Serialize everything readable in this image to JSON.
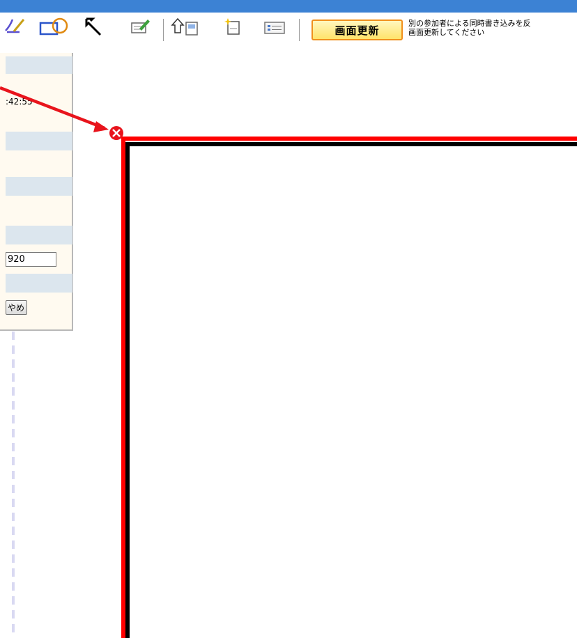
{
  "toolbar": {
    "tools": [
      {
        "icon": "pen-icon"
      },
      {
        "icon": "shape-icon"
      },
      {
        "icon": "select-arrow-icon"
      },
      {
        "icon": "edit-note-icon"
      },
      {
        "icon": "upload-page-icon"
      },
      {
        "icon": "new-page-icon"
      },
      {
        "icon": "list-view-icon"
      }
    ],
    "refresh_label": "画面更新",
    "notice_line1": "別の参加者による同時書き込みを反",
    "notice_line2": "画面更新してください"
  },
  "panel": {
    "timestamp": ":42:55",
    "size_value": "920",
    "cancel_label": "やめ"
  },
  "colors": {
    "topbar": "#3c82d4",
    "canvas_border_red": "#ff0000",
    "canvas_border_black": "#000000",
    "refresh_border": "#f0901c",
    "panel_band": "#dce6ee"
  },
  "annotation": {
    "icon": "close-circle-icon",
    "arrow_color": "#e8141c"
  }
}
